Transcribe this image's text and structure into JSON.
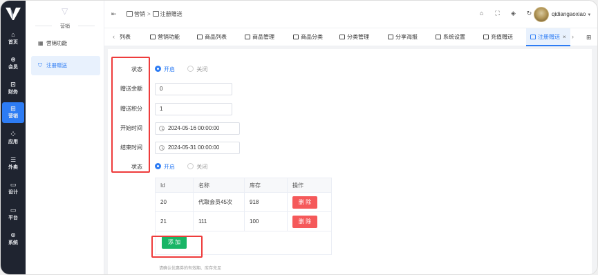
{
  "rail": {
    "items": [
      {
        "label": "首页",
        "icon": "home-icon",
        "glyph": "⌂"
      },
      {
        "label": "会员",
        "icon": "member-icon",
        "glyph": "⊛"
      },
      {
        "label": "财务",
        "icon": "finance-icon",
        "glyph": "⊡"
      },
      {
        "label": "营销",
        "icon": "marketing-icon",
        "glyph": "⊞"
      },
      {
        "label": "应用",
        "icon": "apps-icon",
        "glyph": "⁘"
      },
      {
        "label": "外卖",
        "icon": "takeout-icon",
        "glyph": "☰"
      },
      {
        "label": "设计",
        "icon": "design-icon",
        "glyph": "▭"
      },
      {
        "label": "平台",
        "icon": "platform-icon",
        "glyph": "▭"
      },
      {
        "label": "系统",
        "icon": "system-icon",
        "glyph": "⊙"
      }
    ],
    "active_index": 3,
    "accent": "#2d7cf4"
  },
  "submenu": {
    "title": "营销",
    "items": [
      {
        "label": "营销功能",
        "icon": "grid-icon"
      },
      {
        "label": "注册赠送",
        "icon": "shield-icon"
      }
    ],
    "active_index": 1
  },
  "header": {
    "breadcrumb": [
      "营销",
      "注册赠送"
    ],
    "username": "qidiangaoxiao"
  },
  "tabs": {
    "items": [
      {
        "label": "列表"
      },
      {
        "label": "营销功能"
      },
      {
        "label": "商品列表"
      },
      {
        "label": "商品管理"
      },
      {
        "label": "商品分类"
      },
      {
        "label": "分类管理"
      },
      {
        "label": "分享海报"
      },
      {
        "label": "系统设置"
      },
      {
        "label": "充值赠送"
      },
      {
        "label": "注册赠送"
      }
    ],
    "active_index": 9
  },
  "form": {
    "status_label": "状态",
    "on_label": "开启",
    "off_label": "关闭",
    "balance_label": "赠送余额",
    "balance_value": "0",
    "points_label": "赠送积分",
    "points_value": "1",
    "start_label": "开始时间",
    "start_value": "2024-05-16 00:00:00",
    "end_label": "结束时间",
    "end_value": "2024-05-31 00:00:00",
    "status2_label": "状态"
  },
  "table": {
    "headers": [
      "Id",
      "名称",
      "库存",
      "操作"
    ],
    "rows": [
      {
        "id": "20",
        "name": "代取会员45次",
        "stock": "918",
        "action": "删 除"
      },
      {
        "id": "21",
        "name": "111",
        "stock": "100",
        "action": "删 除"
      }
    ],
    "add_label": "添 加",
    "hint": "请确认优惠券的有效期、库存充足"
  },
  "colors": {
    "primary": "#2d7cf4",
    "danger": "#f5595a",
    "success": "#18b566",
    "highlight": "#ee3b3b"
  }
}
